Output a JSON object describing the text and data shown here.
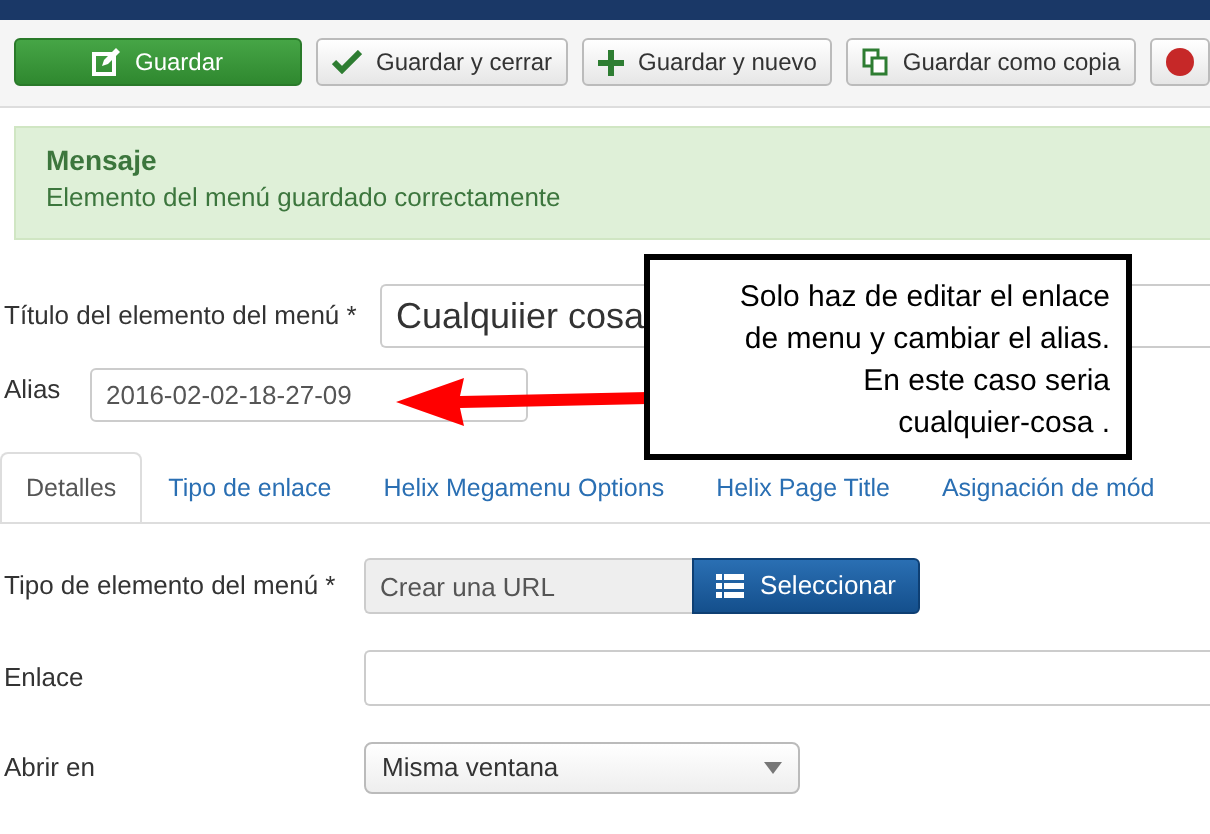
{
  "toolbar": {
    "buttons": [
      {
        "label": "Guardar",
        "kind": "primary"
      },
      {
        "label": "Guardar y cerrar",
        "kind": "default"
      },
      {
        "label": "Guardar y nuevo",
        "kind": "default"
      },
      {
        "label": "Guardar como copia",
        "kind": "default"
      },
      {
        "kind": "default"
      }
    ]
  },
  "alert": {
    "heading": "Mensaje",
    "text": "Elemento del menú guardado correctamente"
  },
  "title_field": {
    "label": "Título del elemento del menú *",
    "value": "Cualquiier cosa"
  },
  "alias_field": {
    "label": "Alias",
    "value": "2016-02-02-18-27-09"
  },
  "callout": {
    "lines": [
      "Solo haz de editar el enlace",
      "de menu y cambiar el alias.",
      "En este caso seria",
      "cualquier-cosa ."
    ]
  },
  "tabs": [
    {
      "label": "Detalles",
      "selected": true
    },
    {
      "label": "Tipo de enlace",
      "selected": false
    },
    {
      "label": "Helix Megamenu Options",
      "selected": false
    },
    {
      "label": "Helix Page Title",
      "selected": false
    },
    {
      "label": "Asignación de mód",
      "selected": false
    }
  ],
  "form_rows": [
    {
      "label": "Tipo de elemento del menú *",
      "kind": "type",
      "value": "Crear una URL",
      "button": "Seleccionar"
    },
    {
      "label": "Enlace",
      "kind": "text",
      "value": ""
    },
    {
      "label": "Abrir en",
      "kind": "select",
      "value": "Misma ventana"
    }
  ]
}
